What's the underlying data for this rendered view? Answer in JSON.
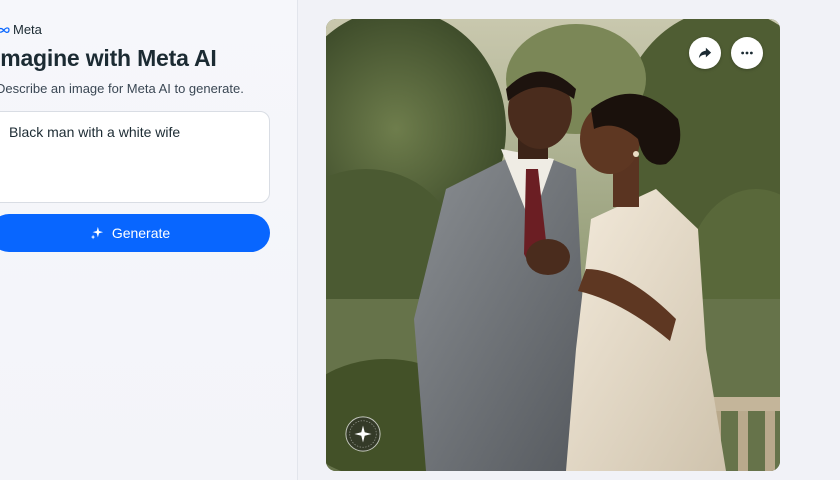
{
  "brand": {
    "name": "Meta",
    "icon": "meta-infinity-icon"
  },
  "header": {
    "title": "Imagine with Meta AI",
    "subtitle": "Describe an image for Meta AI to generate."
  },
  "prompt": {
    "value": "Black man with a white wife"
  },
  "generate": {
    "label": "Generate",
    "icon": "sparkle-icon"
  },
  "image_card": {
    "actions": [
      {
        "name": "share",
        "icon": "share-arrow-icon"
      },
      {
        "name": "more",
        "icon": "more-dots-icon"
      }
    ],
    "watermark_icon": "imagined-with-ai-badge-icon"
  },
  "colors": {
    "accent": "#0866ff",
    "panel_bg": "#f6f7fb",
    "text_primary": "#1c2b33"
  }
}
